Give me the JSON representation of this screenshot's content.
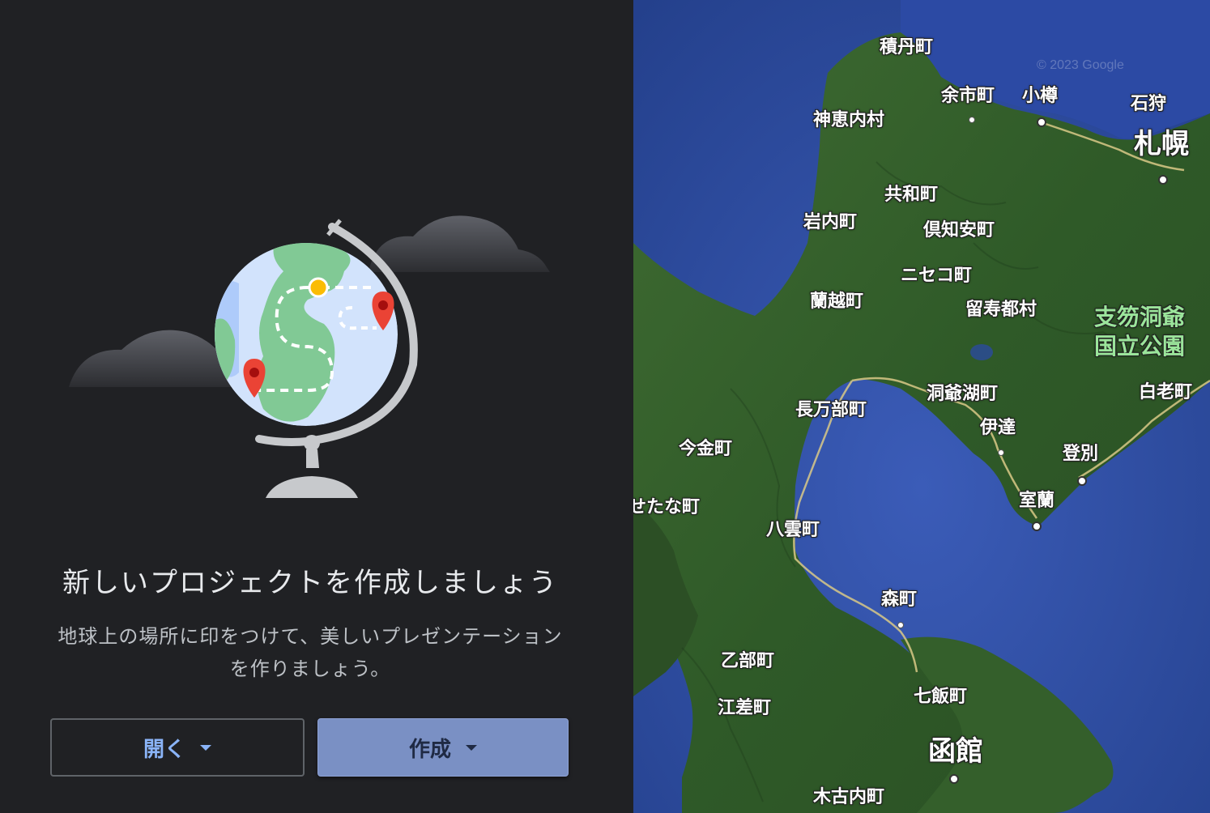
{
  "welcome": {
    "heading": "新しいプロジェクトを作成しましょう",
    "description": "地球上の場所に印をつけて、美しいプレゼンテーションを作りましょう。"
  },
  "buttons": {
    "open_label": "開く",
    "create_label": "作成"
  },
  "map": {
    "credit": "© 2023 Google",
    "labels": {
      "shakotan": "積丹町",
      "yoichi": "余市町",
      "otaru": "小樽",
      "ishikari": "石狩",
      "sapporo": "札幌",
      "kamoenai": "神恵内村",
      "kyowa": "共和町",
      "iwanai": "岩内町",
      "kutchan": "倶知安町",
      "niseko": "ニセコ町",
      "rankoshi": "蘭越町",
      "rusutsu": "留寿都村",
      "shikotsu_toya": "支笏洞爺国立公園",
      "toyako": "洞爺湖町",
      "shiraoi": "白老町",
      "oshamambe": "長万部町",
      "date": "伊達",
      "noboribetsu": "登別",
      "imakane": "今金町",
      "setana": "せたな町",
      "muroran": "室蘭",
      "yakumo": "八雲町",
      "mori": "森町",
      "otobe": "乙部町",
      "esashi": "江差町",
      "nanae": "七飯町",
      "hakodate": "函館",
      "kikonai": "木古内町"
    }
  },
  "colors": {
    "background": "#202124",
    "accent": "#8ab4f8",
    "create_button": "#7a90c4"
  }
}
